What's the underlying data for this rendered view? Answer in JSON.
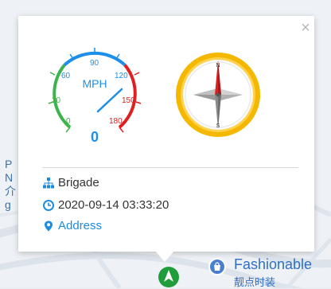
{
  "popup": {
    "close_label": "×",
    "speed": {
      "unit_label": "MPH",
      "value": "0",
      "scale": [
        "0",
        "30",
        "60",
        "90",
        "120",
        "150",
        "180"
      ]
    },
    "compass": {
      "marks": [
        "N",
        "S"
      ]
    },
    "group_label": "Brigade",
    "timestamp": "2020-09-14 03:33:20",
    "address_link": "Address",
    "icons": {
      "group": "sitemap-icon",
      "time": "clock-icon",
      "address": "map-marker-icon"
    }
  },
  "map": {
    "left_fragment": [
      "P",
      "N",
      "介",
      "g"
    ],
    "shop_name": "Fashionable",
    "shop_subtitle": "靓点时装"
  },
  "colors": {
    "speed_green": "#3cb44b",
    "speed_blue": "#1e8fe8",
    "speed_red": "#e02020",
    "compass_ring": "#f5b800",
    "link_blue": "#1d8ce0"
  }
}
